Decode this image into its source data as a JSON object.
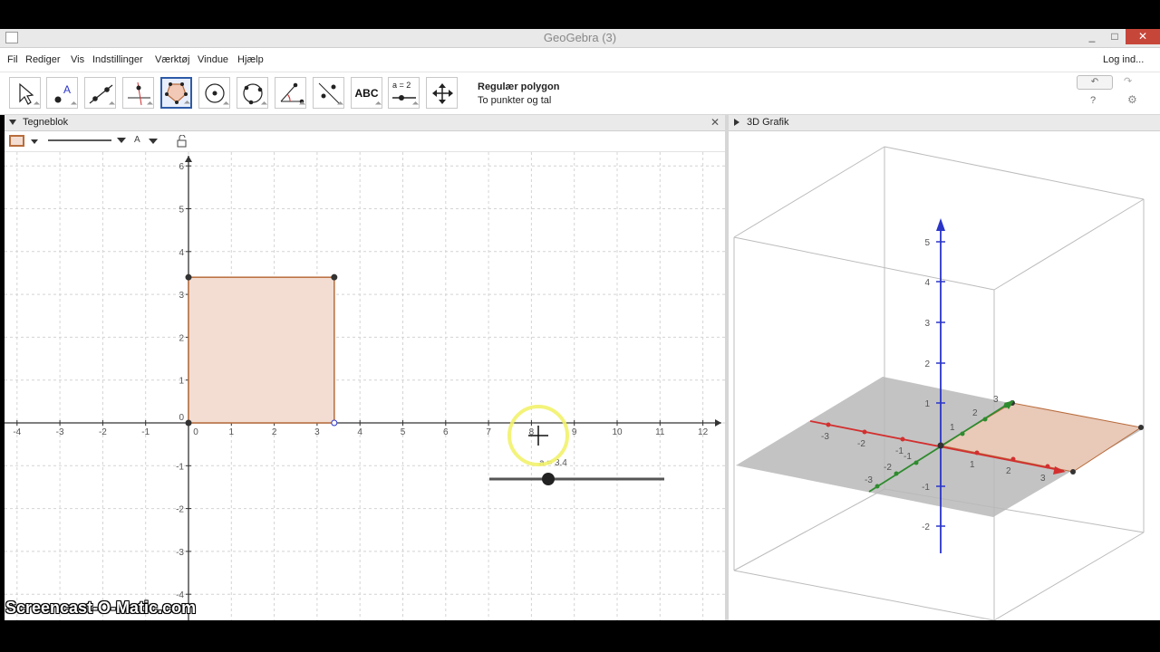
{
  "window": {
    "title": "GeoGebra (3)",
    "minimize": "_",
    "maximize": "□",
    "close": "✕"
  },
  "menu": {
    "items": [
      "Fil",
      "Rediger",
      "Vis",
      "Indstillinger",
      "Værktøj",
      "Vindue",
      "Hjælp"
    ],
    "login": "Log ind..."
  },
  "toolbar": {
    "text_tool_label": "ABC",
    "slider_tool_label": "a = 2",
    "active_tool_name": "Regulær polygon",
    "active_tool_help": "To punkter og tal",
    "undo": "↶",
    "redo": "↷",
    "help": "?",
    "settings": "⚙"
  },
  "graphics_view": {
    "title": "Tegneblok",
    "style_bar_label": "A",
    "x_ticks": [
      "-4",
      "-3",
      "-2",
      "-1",
      "0",
      "1",
      "2",
      "3",
      "4",
      "5",
      "6",
      "7",
      "8",
      "9",
      "10",
      "11",
      "12"
    ],
    "y_ticks_pos": [
      "6",
      "5",
      "4",
      "3",
      "2",
      "1"
    ],
    "y_ticks_neg": [
      "-1",
      "-2",
      "-3",
      "-4"
    ],
    "origin": "0",
    "polygon_color": "#b86c3c",
    "polygon_fill": "#f3ddd2",
    "slider_label": "a = 3.4",
    "slider_value": 3.4,
    "slider_min": 0,
    "slider_max": 10
  },
  "view3d": {
    "title": "3D Grafik",
    "z_ticks": [
      "5",
      "4",
      "3",
      "2",
      "1",
      "-1",
      "-2"
    ],
    "x_ticks": [
      "-3",
      "-2",
      "-1",
      "1",
      "2",
      "3"
    ],
    "y_ticks": [
      "-3",
      "-2",
      "-1",
      "1",
      "2",
      "3"
    ],
    "x_axis_color": "#d32f2f",
    "y_axis_color": "#2e8b2e",
    "z_axis_color": "#2a35c8"
  },
  "watermark": "Screencast-O-Matic.com"
}
